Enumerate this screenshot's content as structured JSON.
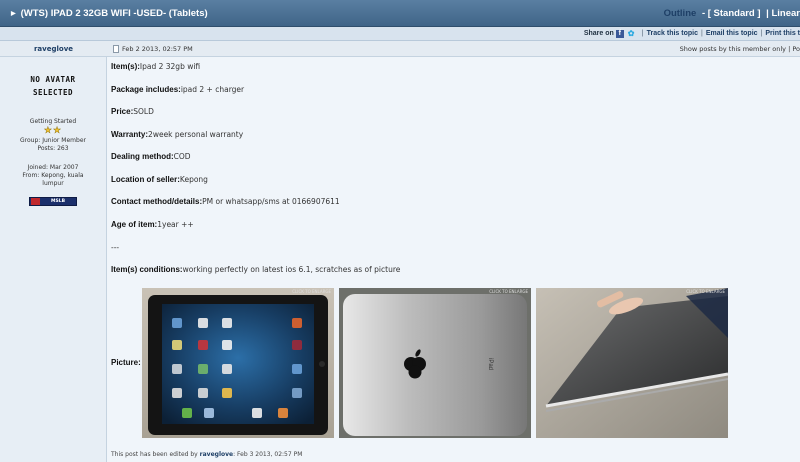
{
  "topic": {
    "title": "(WTS) IPAD 2 32GB WIFI -USED- (Tablets)",
    "view_options": [
      "Outline",
      "-",
      "[ Standard ]",
      "|",
      "Linear"
    ],
    "print_label": "Print this t"
  },
  "share_bar": {
    "share_label": "Share on",
    "track_label": "Track this topic",
    "email_label": "Email this topic",
    "print_label": "Print this t"
  },
  "post": {
    "author": "raveglove",
    "date": "Feb 2 2013, 02:57 PM",
    "show_posts_label": "Show posts by this member only",
    "show_posts_sep": "| Po",
    "avatar_text_line1": "NO AVATAR",
    "avatar_text_line2": "SELECTED",
    "rank": "Getting Started",
    "group": "Group: Junior Member",
    "posts": "Posts: 263",
    "joined": "Joined: Mar 2007",
    "from": "From: Kepong, kuala lumpur",
    "msg_button": "MSLB",
    "fields": [
      {
        "label": "Item(s):",
        "value": "Ipad 2 32gb wifi"
      },
      {
        "label": "Package includes:",
        "value": "ipad 2 + charger"
      },
      {
        "label": "Price:",
        "value": "SOLD"
      },
      {
        "label": "Warranty:",
        "value": "2week personal warranty"
      },
      {
        "label": "Dealing method:",
        "value": "COD"
      },
      {
        "label": "Location of seller:",
        "value": "Kepong"
      },
      {
        "label": "Contact method/details:",
        "value": "PM or whatsapp/sms at 0166907611"
      },
      {
        "label": "Age of item:",
        "value": "1year ++"
      }
    ],
    "divider": "---",
    "conditions_label": "Item(s) conditions:",
    "conditions_value": "working perfectly on latest ios 6.1, scratches as of picture",
    "picture_label": "Picture:",
    "enlarge_label": "CLICK TO ENLARGE",
    "edited_prefix": "This post has been edited by",
    "edited_by": "raveglove",
    "edited_date": ": Feb 3 2013, 02:57 PM"
  }
}
